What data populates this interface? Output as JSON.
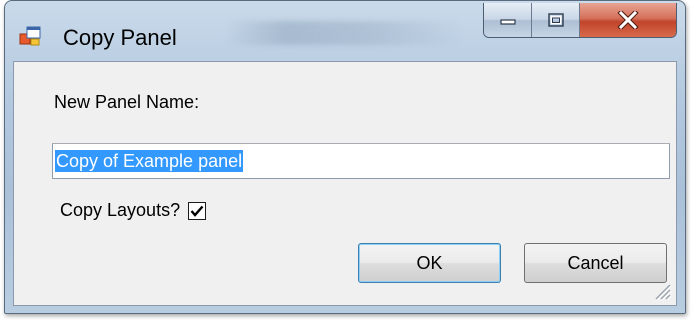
{
  "window": {
    "title": "Copy Panel",
    "app_icon": "windows-form-icon",
    "minimize_icon": "minimize-icon",
    "maximize_icon": "maximize-icon",
    "close_icon": "close-icon"
  },
  "form": {
    "name_label": "New Panel Name:",
    "name_value": "Copy of Example panel",
    "copy_layouts_label": "Copy Layouts?",
    "copy_layouts_checked": true
  },
  "buttons": {
    "ok_label": "OK",
    "cancel_label": "Cancel"
  },
  "colors": {
    "selection": "#3399ff",
    "close_button": "#c0442a",
    "default_button_border": "#3c7fb1"
  }
}
